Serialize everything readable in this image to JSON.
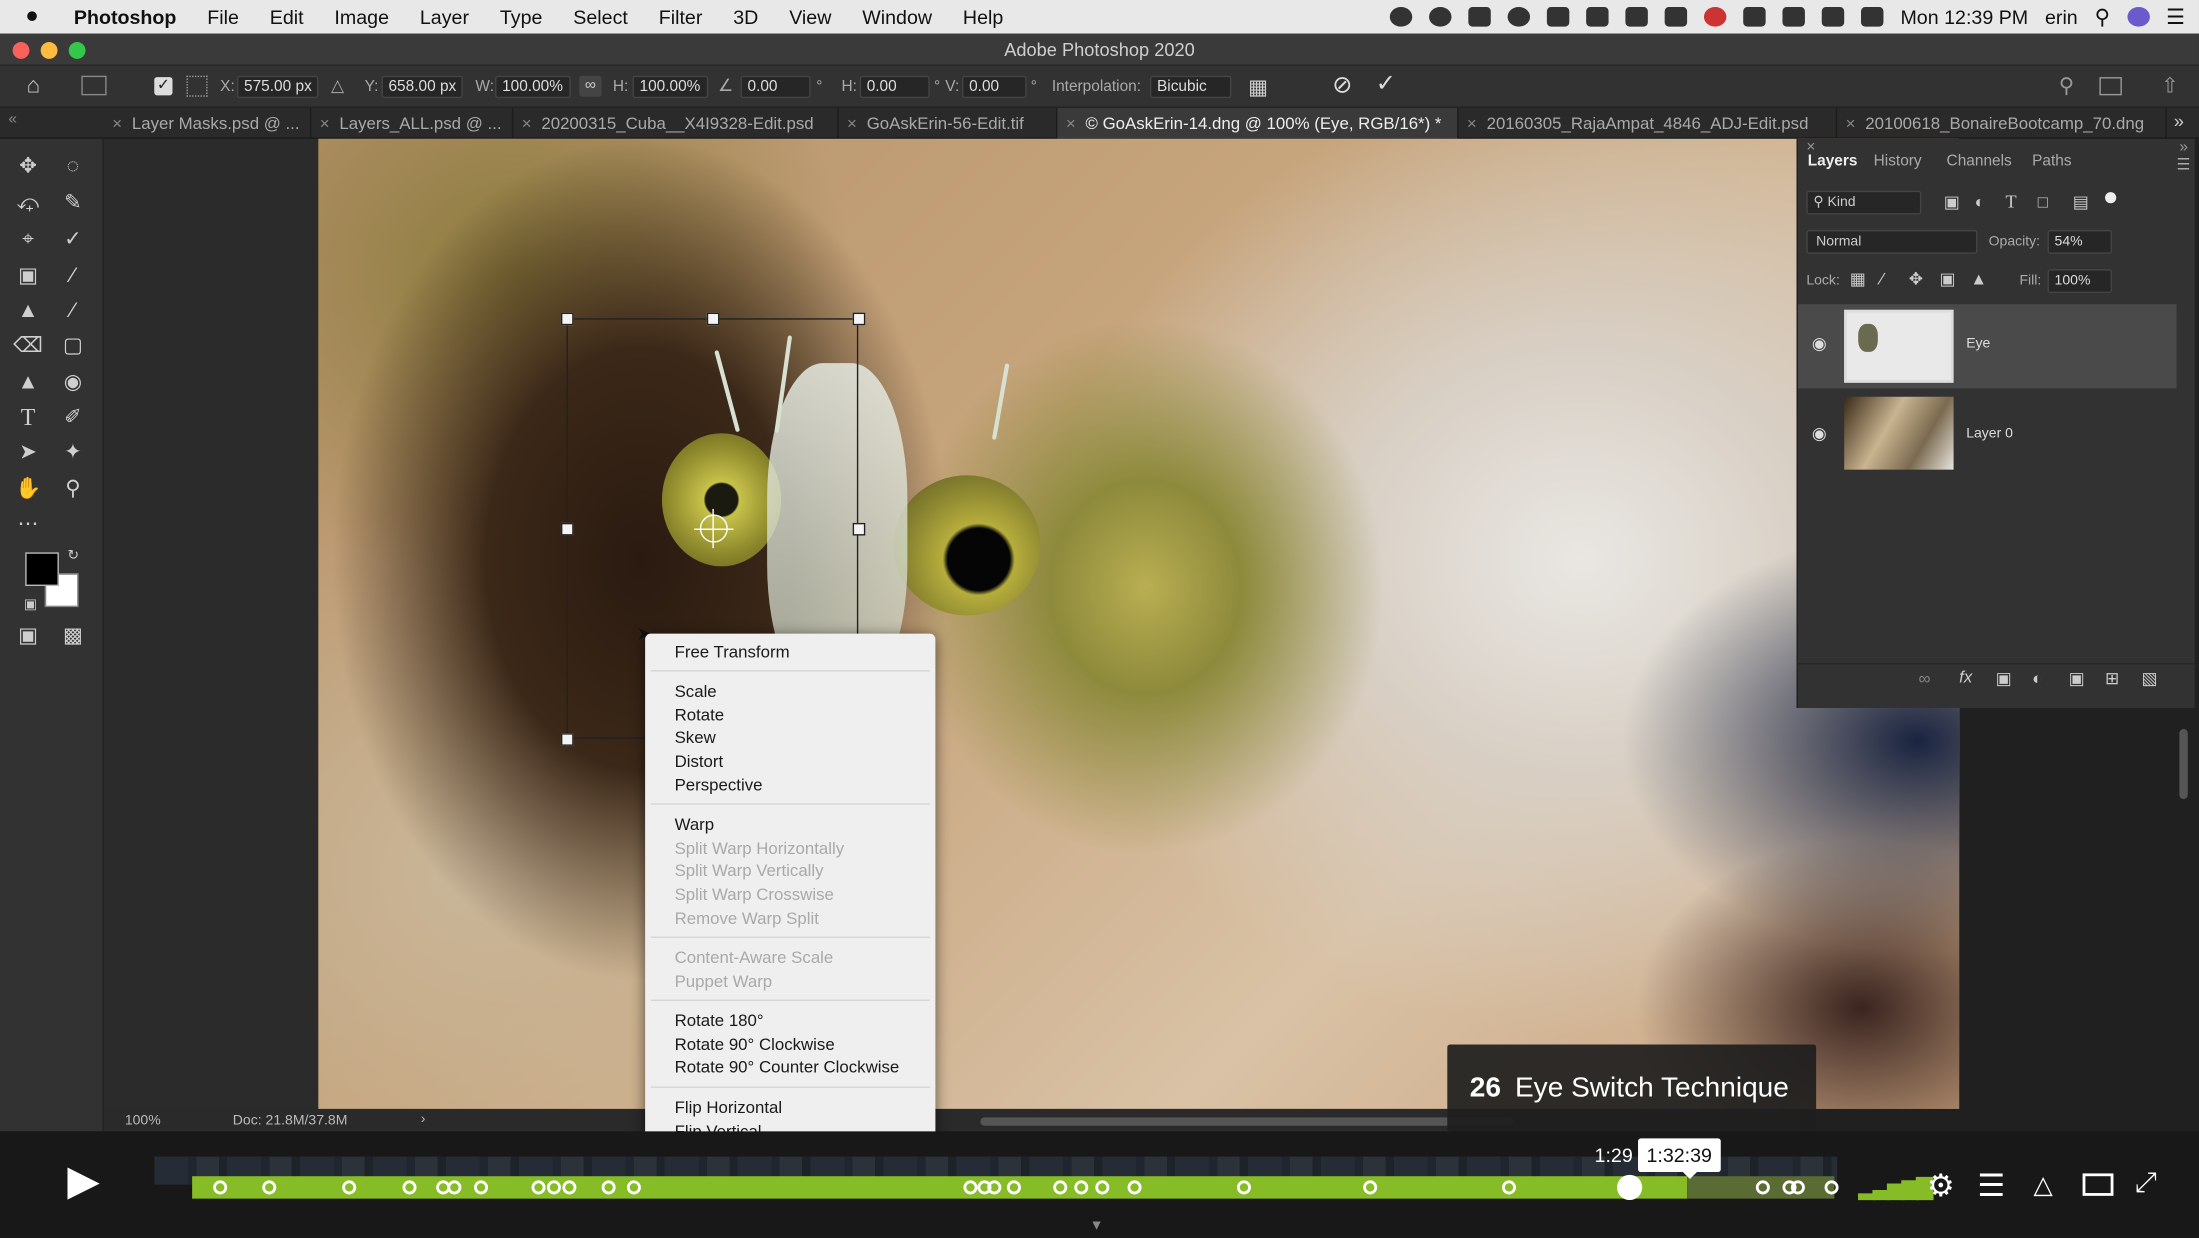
{
  "menubar": {
    "apple": "",
    "items": [
      "Photoshop",
      "File",
      "Edit",
      "Image",
      "Layer",
      "Type",
      "Select",
      "Filter",
      "3D",
      "View",
      "Window",
      "Help"
    ],
    "clock": "Mon 12:39 PM",
    "user": "erin"
  },
  "window": {
    "title": "Adobe Photoshop 2020"
  },
  "options": {
    "x_label": "X:",
    "x_value": "575.00 px",
    "y_label": "Y:",
    "y_value": "658.00 px",
    "w_label": "W:",
    "w_value": "100.00%",
    "h_label": "H:",
    "h_value": "100.00%",
    "angle_value": "0.00",
    "angle_unit": "°",
    "hskew_label": "H:",
    "hskew_value": "0.00",
    "vskew_label": "V:",
    "vskew_value": "0.00",
    "degree": "°",
    "interp_label": "Interpolation:",
    "interp_value": "Bicubic"
  },
  "tabs": [
    {
      "label": "Layer Masks.psd @ ..."
    },
    {
      "label": "Layers_ALL.psd @ ..."
    },
    {
      "label": "20200315_Cuba__X4I9328-Edit.psd"
    },
    {
      "label": "GoAskErin-56-Edit.tif"
    },
    {
      "label": "© GoAskErin-14.dng @ 100% (Eye, RGB/16*) *"
    },
    {
      "label": "20160305_RajaAmpat_4846_ADJ-Edit.psd"
    },
    {
      "label": "20100618_BonaireBootcamp_70.dng"
    }
  ],
  "status": {
    "zoom": "100%",
    "doc": "Doc: 21.8M/37.8M",
    "arrow": "›"
  },
  "panel": {
    "tabs": [
      "Layers",
      "History",
      "Channels",
      "Paths"
    ],
    "kind_label": "Kind",
    "blend_mode": "Normal",
    "opacity_label": "Opacity:",
    "opacity_value": "54%",
    "lock_label": "Lock:",
    "fill_label": "Fill:",
    "fill_value": "100%",
    "layers": [
      {
        "name": "Eye"
      },
      {
        "name": "Layer 0"
      }
    ]
  },
  "context_menu": {
    "groups": [
      [
        {
          "label": "Free Transform",
          "enabled": true
        }
      ],
      [
        {
          "label": "Scale",
          "enabled": true
        },
        {
          "label": "Rotate",
          "enabled": true
        },
        {
          "label": "Skew",
          "enabled": true
        },
        {
          "label": "Distort",
          "enabled": true
        },
        {
          "label": "Perspective",
          "enabled": true
        }
      ],
      [
        {
          "label": "Warp",
          "enabled": true
        },
        {
          "label": "Split Warp Horizontally",
          "enabled": false
        },
        {
          "label": "Split Warp Vertically",
          "enabled": false
        },
        {
          "label": "Split Warp Crosswise",
          "enabled": false
        },
        {
          "label": "Remove Warp Split",
          "enabled": false
        }
      ],
      [
        {
          "label": "Content-Aware Scale",
          "enabled": false
        },
        {
          "label": "Puppet Warp",
          "enabled": false
        }
      ],
      [
        {
          "label": "Rotate 180°",
          "enabled": true
        },
        {
          "label": "Rotate 90° Clockwise",
          "enabled": true
        },
        {
          "label": "Rotate 90° Counter Clockwise",
          "enabled": true
        }
      ],
      [
        {
          "label": "Flip Horizontal",
          "enabled": true
        },
        {
          "label": "Flip Vertical",
          "enabled": true
        }
      ]
    ]
  },
  "video": {
    "chapter_number": "26",
    "chapter_title": "Eye Switch Technique",
    "elapsed": "1:29",
    "hover_time": "1:32:39",
    "progress": 0.958,
    "accent": "#86bc25"
  }
}
